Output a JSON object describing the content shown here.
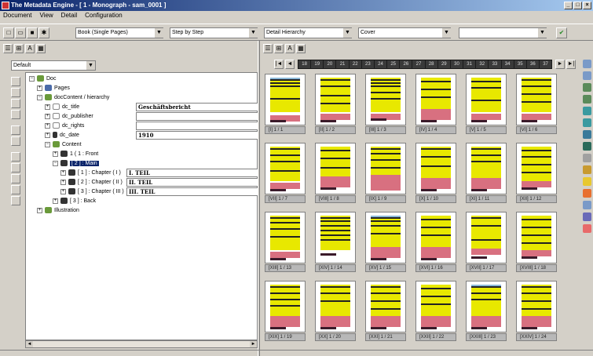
{
  "window": {
    "title": "The Metadata Engine - [ 1 - Monograph - sam_0001 ]",
    "controls": [
      "_",
      "□",
      "×"
    ]
  },
  "menu": [
    "Document",
    "View",
    "Detail",
    "Configuration"
  ],
  "toolbar": {
    "view_mode": "Book (Single Pages)",
    "navigation": "Step by Step",
    "structure": "Detail Hierarchy",
    "item": "Cover",
    "extra": ""
  },
  "left_panel": {
    "preset": "Default",
    "tree": [
      {
        "label": "Doc",
        "level": 0,
        "icon": "doc-icon"
      },
      {
        "label": "Pages",
        "level": 1,
        "icon": "pages-icon"
      },
      {
        "label": "docContent / hierarchy",
        "level": 1,
        "icon": "hierarchy-icon"
      },
      {
        "label": "dc_title",
        "level": 2,
        "icon": "field-icon"
      },
      {
        "label": "dc_publisher",
        "level": 2,
        "icon": "field-icon"
      },
      {
        "label": "dc_rights",
        "level": 2,
        "icon": "field-icon"
      },
      {
        "label": "dc_date",
        "level": 2,
        "icon": "date-icon"
      },
      {
        "label": "Content",
        "level": 2,
        "icon": "content-icon"
      },
      {
        "label": "1 ( 1 : Front",
        "level": 3,
        "icon": "chapter-icon"
      },
      {
        "label": "[ 2 ] : Main",
        "level": 3,
        "icon": "chapter-icon"
      },
      {
        "label": "[ 1 ] : Chapter ( I )",
        "level": 4,
        "icon": "chapter-icon"
      },
      {
        "label": "[ 2 ] : Chapter ( II )",
        "level": 4,
        "icon": "chapter-icon"
      },
      {
        "label": "[ 3 ] : Chapter ( III )",
        "level": 4,
        "icon": "chapter-icon"
      },
      {
        "label": "[ 3 ] : Back",
        "level": 3,
        "icon": "chapter-icon"
      },
      {
        "label": "Illustration",
        "level": 1,
        "icon": "illustration-icon"
      }
    ],
    "fields": {
      "dc_title": "Geschäftsbericht",
      "dc_publisher": "",
      "dc_rights": "",
      "dc_date": "1910",
      "chapter1": "I. TEIL",
      "chapter2": "II. TEIL",
      "chapter3": "III. TEIL"
    }
  },
  "right_panel": {
    "page_numbers": [
      "18",
      "19",
      "20",
      "21",
      "22",
      "23",
      "24",
      "25",
      "26",
      "27",
      "28",
      "29",
      "30",
      "31",
      "32",
      "33",
      "34",
      "35",
      "36",
      "37"
    ],
    "thumbnails": [
      {
        "caption": "[I] 1 / 1"
      },
      {
        "caption": "[II] 1 / 2"
      },
      {
        "caption": "[III] 1 / 3"
      },
      {
        "caption": "[IV] 1 / 4"
      },
      {
        "caption": "[V] 1 / 5"
      },
      {
        "caption": "[VI] 1 / 6"
      },
      {
        "caption": "[VII] 1 / 7"
      },
      {
        "caption": "[VIII] 1 / 8"
      },
      {
        "caption": "[IX] 1 / 9"
      },
      {
        "caption": "[X] 1 / 10"
      },
      {
        "caption": "[XI] 1 / 11"
      },
      {
        "caption": "[XII] 1 / 12"
      },
      {
        "caption": "[XIII] 1 / 13"
      },
      {
        "caption": "[XIV] 1 / 14"
      },
      {
        "caption": "[XV] 1 / 15"
      },
      {
        "caption": "[XVI] 1 / 16"
      },
      {
        "caption": "[XVII] 1 / 17"
      },
      {
        "caption": "[XVIII] 1 / 18"
      },
      {
        "caption": "[XIX] 1 / 19"
      },
      {
        "caption": "[XX] 1 / 20"
      },
      {
        "caption": "[XXI] 1 / 21"
      },
      {
        "caption": "[XXII] 1 / 22"
      },
      {
        "caption": "[XXIII] 1 / 23"
      },
      {
        "caption": "[XXIV] 1 / 24"
      }
    ]
  },
  "colors": {
    "page_highlight": "#e8e800",
    "region_pink": "#d87080",
    "selection": "#0a246a"
  }
}
